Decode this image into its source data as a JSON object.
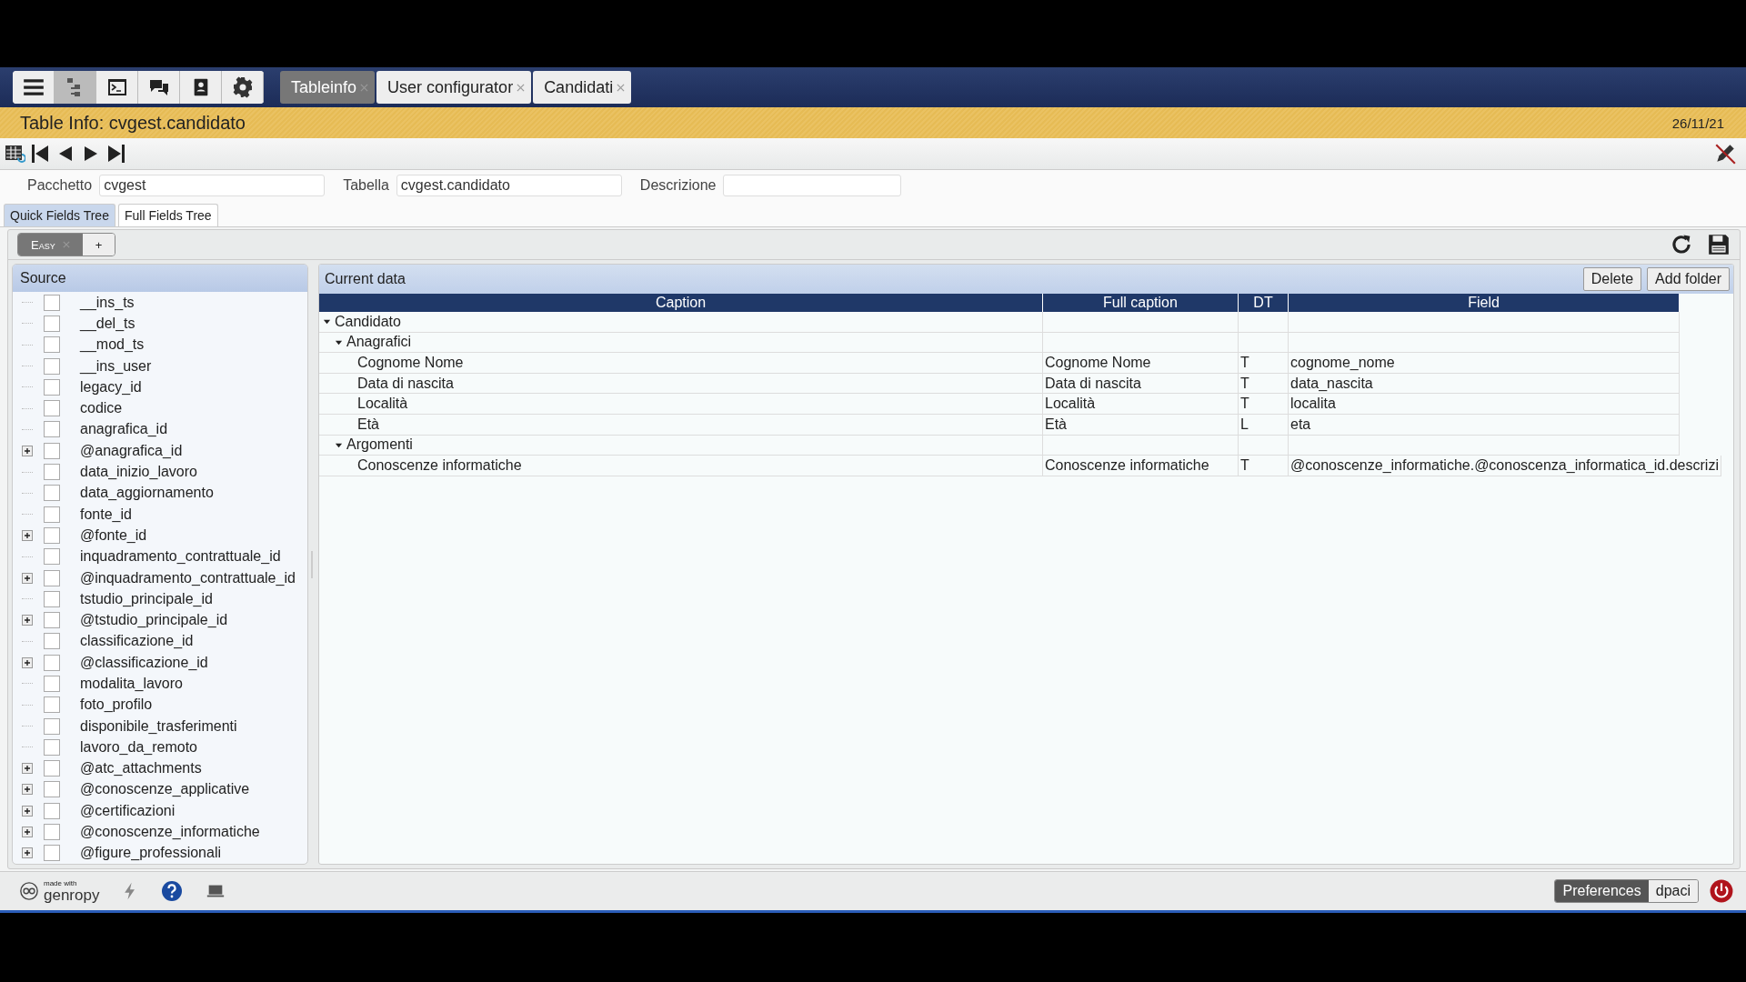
{
  "toolbar": {
    "tabs": [
      {
        "label": "Tableinfo",
        "selected": true
      },
      {
        "label": "User configurator",
        "selected": false
      },
      {
        "label": "Candidati",
        "selected": false
      }
    ]
  },
  "title_bar": {
    "title": "Table Info: cvgest.candidato",
    "date": "26/11/21"
  },
  "form": {
    "fields": [
      {
        "label": "Pacchetto",
        "value": "cvgest"
      },
      {
        "label": "Tabella",
        "value": "cvgest.candidato"
      },
      {
        "label": "Descrizione"
      }
    ]
  },
  "view_tabs": [
    {
      "label": "Quick Fields Tree",
      "selected": true
    },
    {
      "label": "Full Fields Tree",
      "selected": false
    }
  ],
  "mode_tabs": [
    {
      "label": "Easy",
      "selected": true,
      "closable": true
    },
    {
      "label": "+",
      "selected": false,
      "closable": false
    }
  ],
  "source": {
    "title": "Source",
    "items": [
      {
        "label": "__ins_ts",
        "expandable": false,
        "checked": false
      },
      {
        "label": "__del_ts",
        "expandable": false,
        "checked": false
      },
      {
        "label": "__mod_ts",
        "expandable": false,
        "checked": false
      },
      {
        "label": "__ins_user",
        "expandable": false,
        "checked": false
      },
      {
        "label": "legacy_id",
        "expandable": false,
        "checked": false
      },
      {
        "label": "codice",
        "expandable": false,
        "checked": false
      },
      {
        "label": "anagrafica_id",
        "expandable": false,
        "checked": false
      },
      {
        "label": "@anagrafica_id",
        "expandable": true,
        "checked": false
      },
      {
        "label": "data_inizio_lavoro",
        "expandable": false,
        "checked": false
      },
      {
        "label": "data_aggiornamento",
        "expandable": false,
        "checked": false
      },
      {
        "label": "fonte_id",
        "expandable": false,
        "checked": false
      },
      {
        "label": "@fonte_id",
        "expandable": true,
        "checked": false
      },
      {
        "label": "inquadramento_contrattuale_id",
        "expandable": false,
        "checked": false
      },
      {
        "label": "@inquadramento_contrattuale_id",
        "expandable": true,
        "checked": false
      },
      {
        "label": "tstudio_principale_id",
        "expandable": false,
        "checked": false
      },
      {
        "label": "@tstudio_principale_id",
        "expandable": true,
        "checked": false
      },
      {
        "label": "classificazione_id",
        "expandable": false,
        "checked": false
      },
      {
        "label": "@classificazione_id",
        "expandable": true,
        "checked": false
      },
      {
        "label": "modalita_lavoro",
        "expandable": false,
        "checked": false
      },
      {
        "label": "foto_profilo",
        "expandable": false,
        "checked": false
      },
      {
        "label": "disponibile_trasferimenti",
        "expandable": false,
        "checked": false
      },
      {
        "label": "lavoro_da_remoto",
        "expandable": false,
        "checked": false
      },
      {
        "label": "@atc_attachments",
        "expandable": true,
        "checked": false
      },
      {
        "label": "@conoscenze_applicative",
        "expandable": true,
        "checked": false
      },
      {
        "label": "@certificazioni",
        "expandable": true,
        "checked": false
      },
      {
        "label": "@conoscenze_informatiche",
        "expandable": true,
        "checked": false
      },
      {
        "label": "@figure_professionali",
        "expandable": true,
        "checked": false
      }
    ]
  },
  "current_data": {
    "title": "Current data",
    "buttons": [
      "Delete",
      "Add folder"
    ],
    "columns": [
      "Caption",
      "Full caption",
      "DT",
      "Field"
    ],
    "rows": [
      {
        "caption": "Candidato",
        "expanded": true,
        "children": [
          {
            "caption": "Anagrafici",
            "expanded": true,
            "children": [
              {
                "caption": "Cognome Nome",
                "full_caption": "Cognome Nome",
                "dt": "T",
                "field": "cognome_nome"
              },
              {
                "caption": "Data di nascita",
                "full_caption": "Data di nascita",
                "dt": "T",
                "field": "data_nascita"
              },
              {
                "caption": "Località",
                "full_caption": "Località",
                "dt": "T",
                "field": "localita"
              },
              {
                "caption": "Età",
                "full_caption": "Età",
                "dt": "L",
                "field": "eta"
              }
            ]
          },
          {
            "caption": "Argomenti",
            "expanded": true,
            "children": [
              {
                "caption": "Conoscenze informatiche",
                "full_caption": "Conoscenze informatiche",
                "dt": "T",
                "field": "@conoscenze_informatiche.@conoscenza_informatica_id.descrizi"
              }
            ]
          }
        ]
      }
    ]
  },
  "status_bar": {
    "brand_small": "made with",
    "brand": "genropy",
    "buttons": [
      {
        "label": "Preferences",
        "selected": true
      },
      {
        "label": "dpaci",
        "selected": false
      }
    ]
  }
}
